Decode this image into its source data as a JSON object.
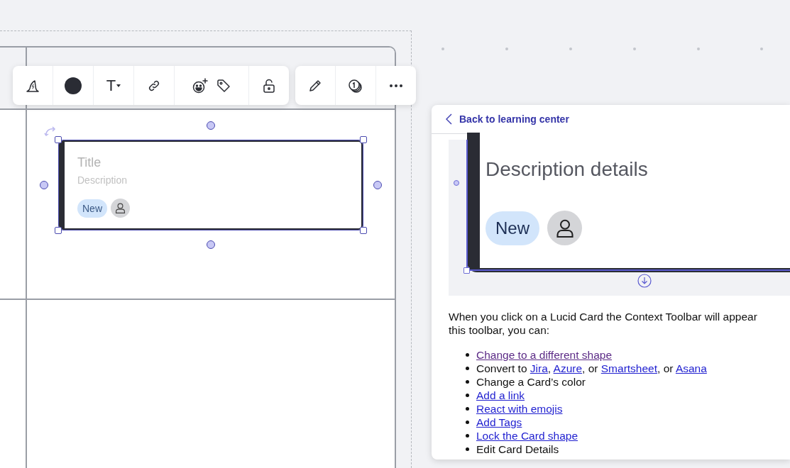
{
  "toolbar": {
    "groups": [
      {
        "cells": [
          [
            {
              "kind": "wizard"
            }
          ],
          [
            {
              "kind": "color"
            }
          ],
          [
            {
              "kind": "text",
              "label": "T"
            }
          ],
          [
            {
              "kind": "link"
            }
          ],
          [
            {
              "kind": "emoji"
            },
            {
              "kind": "tag"
            }
          ],
          [
            {
              "kind": "lock"
            }
          ]
        ]
      },
      {
        "cells": [
          [
            {
              "kind": "edit"
            }
          ],
          [
            {
              "kind": "coins"
            }
          ],
          [
            {
              "kind": "more"
            }
          ]
        ]
      }
    ]
  },
  "canvas": {
    "card": {
      "title": "Title",
      "description": "Description",
      "tag": "New"
    }
  },
  "help_panel": {
    "back_link": "Back to learning center",
    "preview": {
      "description": "Description details",
      "tag": "New"
    },
    "intro_lines": [
      "When you click on a Lucid Card the Context Toolbar will appear",
      "this toolbar, you can:"
    ],
    "list": [
      {
        "parts": [
          {
            "kind": "link",
            "text": "Change to a different shape",
            "visited": true
          }
        ]
      },
      {
        "parts": [
          {
            "kind": "text",
            "text": "Convert to "
          },
          {
            "kind": "link",
            "text": "Jira",
            "visited": false
          },
          {
            "kind": "text",
            "text": ", "
          },
          {
            "kind": "link",
            "text": "Azure",
            "visited": false
          },
          {
            "kind": "text",
            "text": ", or "
          },
          {
            "kind": "link",
            "text": "Smartsheet",
            "visited": false
          },
          {
            "kind": "text",
            "text": ", or "
          },
          {
            "kind": "link",
            "text": "Asana",
            "visited": false
          }
        ]
      },
      {
        "parts": [
          {
            "kind": "text",
            "text": "Change a Card’s color"
          }
        ]
      },
      {
        "parts": [
          {
            "kind": "link",
            "text": "Add a link",
            "visited": false
          }
        ]
      },
      {
        "parts": [
          {
            "kind": "link",
            "text": "React with emojis",
            "visited": false
          }
        ]
      },
      {
        "parts": [
          {
            "kind": "link",
            "text": "Add Tags",
            "visited": false
          }
        ]
      },
      {
        "parts": [
          {
            "kind": "link",
            "text": "Lock the Card shape",
            "visited": false
          }
        ]
      },
      {
        "parts": [
          {
            "kind": "text",
            "text": "Edit Card Details"
          }
        ]
      }
    ]
  }
}
